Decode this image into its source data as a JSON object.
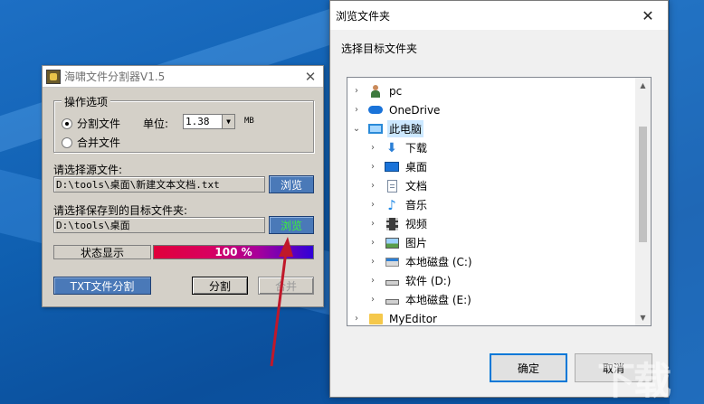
{
  "app": {
    "title": "海啸文件分割器V1.5",
    "close_glyph": "✕",
    "group_title": "操作选项",
    "option_split": "分割文件",
    "option_merge": "合并文件",
    "unit_label": "单位:",
    "unit_value": "1.38",
    "unit_suffix": "MB",
    "source_label": "请选择源文件:",
    "source_path": "D:\\tools\\桌面\\新建文本文档.txt",
    "browse1": "浏览",
    "target_label": "请选择保存到的目标文件夹:",
    "target_path": "D:\\tools\\桌面",
    "browse2": "浏览",
    "status_label": "状态显示",
    "progress_text": "100 %",
    "progress_value": 100,
    "txt_split": "TXT文件分割",
    "split": "分割",
    "merge": "合并"
  },
  "dialog": {
    "title": "浏览文件夹",
    "close_glyph": "✕",
    "instruction": "选择目标文件夹",
    "items": [
      {
        "label": "pc",
        "icon": "user-icon",
        "chevron": ">",
        "indent": 0
      },
      {
        "label": "OneDrive",
        "icon": "cloud-icon",
        "chevron": ">",
        "indent": 0
      },
      {
        "label": "此电脑",
        "icon": "computer-icon",
        "chevron": "v",
        "indent": 0,
        "selected": true
      },
      {
        "label": "下载",
        "icon": "download-icon",
        "chevron": ">",
        "indent": 1
      },
      {
        "label": "桌面",
        "icon": "desktop-icon",
        "chevron": ">",
        "indent": 1
      },
      {
        "label": "文档",
        "icon": "document-icon",
        "chevron": ">",
        "indent": 1
      },
      {
        "label": "音乐",
        "icon": "music-icon",
        "chevron": ">",
        "indent": 1
      },
      {
        "label": "视频",
        "icon": "video-icon",
        "chevron": ">",
        "indent": 1
      },
      {
        "label": "图片",
        "icon": "picture-icon",
        "chevron": ">",
        "indent": 1
      },
      {
        "label": "本地磁盘 (C:)",
        "icon": "system-drive-icon",
        "chevron": ">",
        "indent": 1
      },
      {
        "label": "软件 (D:)",
        "icon": "drive-icon",
        "chevron": ">",
        "indent": 1
      },
      {
        "label": "本地磁盘 (E:)",
        "icon": "drive-icon",
        "chevron": ">",
        "indent": 1
      },
      {
        "label": "MyEditor",
        "icon": "folder-icon",
        "chevron": ">",
        "indent": 0
      }
    ],
    "ok": "确定",
    "cancel": "取消"
  },
  "colors": {
    "accent": "#0078d7",
    "browse_button": "#4a79b8",
    "progress_start": "#e0003a",
    "progress_end": "#3000d8",
    "arrow": "#c0182a"
  }
}
